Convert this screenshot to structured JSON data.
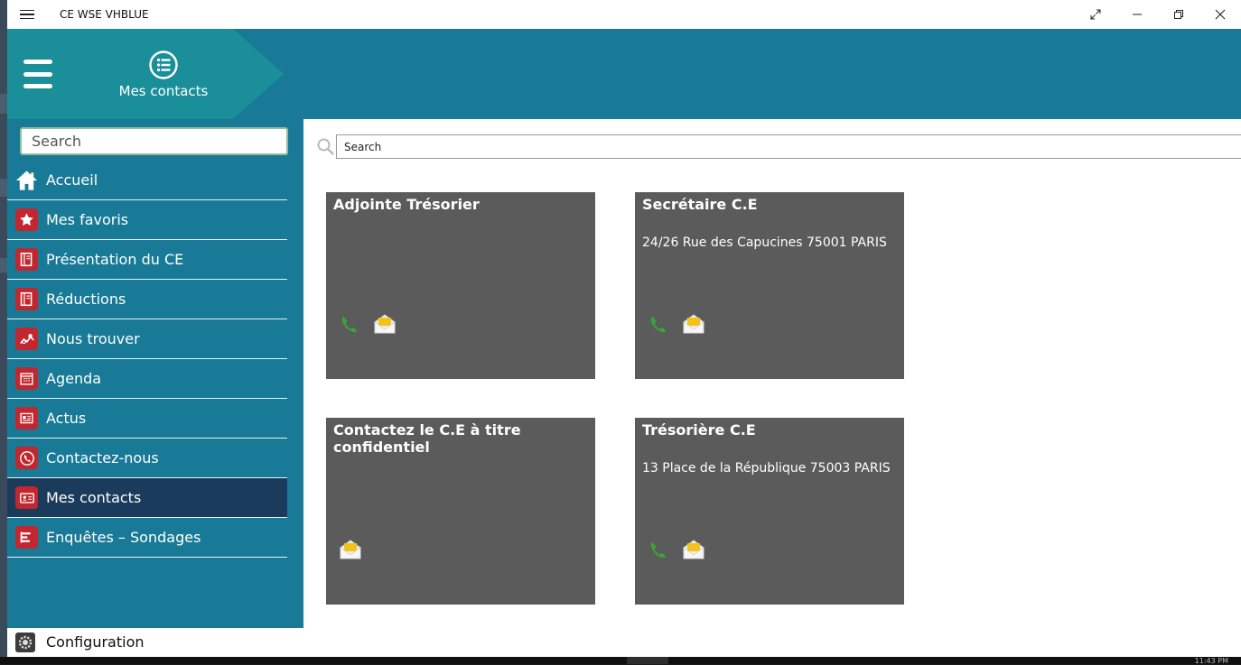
{
  "window": {
    "title": "CE WSE VHBLUE"
  },
  "header": {
    "page_title": "Mes contacts"
  },
  "sidebar": {
    "search_placeholder": "Search",
    "items": [
      {
        "label": "Accueil",
        "icon": "home-icon"
      },
      {
        "label": "Mes favoris",
        "icon": "star-icon"
      },
      {
        "label": "Présentation du CE",
        "icon": "book-icon"
      },
      {
        "label": "Réductions",
        "icon": "book-icon"
      },
      {
        "label": "Nous trouver",
        "icon": "map-pin-icon"
      },
      {
        "label": "Agenda",
        "icon": "calendar-icon"
      },
      {
        "label": "Actus",
        "icon": "newspaper-icon"
      },
      {
        "label": "Contactez-nous",
        "icon": "phone-circle-icon"
      },
      {
        "label": "Mes contacts",
        "icon": "contact-card-icon",
        "active": true
      },
      {
        "label": "Enquêtes – Sondages",
        "icon": "survey-icon"
      }
    ],
    "config_label": "Configuration"
  },
  "main": {
    "search_placeholder": "Search",
    "contacts": [
      {
        "name": "Adjointe Trésorier",
        "address": "",
        "has_phone": true,
        "has_email": true
      },
      {
        "name": "Secrétaire C.E",
        "address": "24/26 Rue des Capucines 75001 PARIS",
        "has_phone": true,
        "has_email": true
      },
      {
        "name": "Contactez le C.E à titre confidentiel",
        "address": "",
        "has_phone": false,
        "has_email": true
      },
      {
        "name": "Trésorière C.E",
        "address": "13 Place de la République 75003 PARIS",
        "has_phone": true,
        "has_email": true
      }
    ]
  },
  "colors": {
    "header_bg": "#187a96",
    "tab_bg": "#1a8f9a",
    "nav_active": "#1b3b5c",
    "icon_red": "#c2262e",
    "card_bg": "#5b5b5b",
    "phone_green": "#3aa33a",
    "mail_yellow": "#f2c21a"
  },
  "taskbar": {
    "clock": "11:43 PM"
  }
}
